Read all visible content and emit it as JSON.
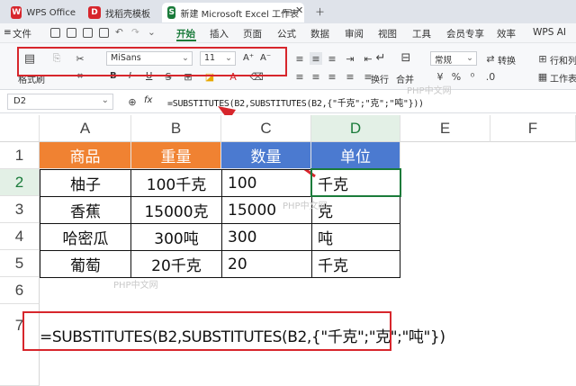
{
  "tabs": [
    {
      "label": "WPS Office",
      "logo": "W",
      "color": "#d7262c"
    },
    {
      "label": "找稻壳模板",
      "logo": "D",
      "color": "#d7262c"
    },
    {
      "label": "新建 Microsoft Excel 工作表",
      "logo": "S",
      "color": "#1a7b3a"
    }
  ],
  "menu": {
    "file": "文件",
    "items": [
      "开始",
      "插入",
      "页面",
      "公式",
      "数据",
      "审阅",
      "视图",
      "工具",
      "会员专享",
      "效率"
    ],
    "wps_ai": "WPS AI"
  },
  "ribbon": {
    "paste_label": "格式刷",
    "font_name": "MiSans",
    "font_size": "11",
    "grow_font": "A⁺",
    "shrink_font": "A⁻",
    "bold": "B",
    "italic": "I",
    "underline": "U",
    "wrap_label": "换行",
    "merge_label": "合并",
    "number_format": "常规",
    "convert_label": "转换",
    "rowcol_label": "行和列",
    "sheet_label": "工作表"
  },
  "formula_bar": {
    "name_box": "D2",
    "fx": "fx",
    "formula": "=SUBSTITUTES(B2,SUBSTITUTES(B2,{\"千克\";\"克\";\"吨\"}))"
  },
  "sheet": {
    "columns": [
      "A",
      "B",
      "C",
      "D",
      "E",
      "F"
    ],
    "rows": [
      "1",
      "2",
      "3",
      "4",
      "5",
      "6",
      "7"
    ],
    "headers": [
      "商品",
      "重量",
      "数量",
      "单位"
    ],
    "data": [
      [
        "柚子",
        "100千克",
        "100",
        "千克"
      ],
      [
        "香蕉",
        "15000克",
        "15000",
        "克"
      ],
      [
        "哈密瓜",
        "300吨",
        "300",
        "吨"
      ],
      [
        "葡萄",
        "20千克",
        "20",
        "千克"
      ]
    ],
    "header_colors": {
      "orange": "#f08232",
      "blue": "#4b7ad0"
    },
    "selected_cell": "D2"
  },
  "annotation": {
    "big_formula": "=SUBSTITUTES(B2,SUBSTITUTES(B2,{\"千克\";\"克\";\"吨\"})",
    "watermark": "PHP中文网"
  }
}
